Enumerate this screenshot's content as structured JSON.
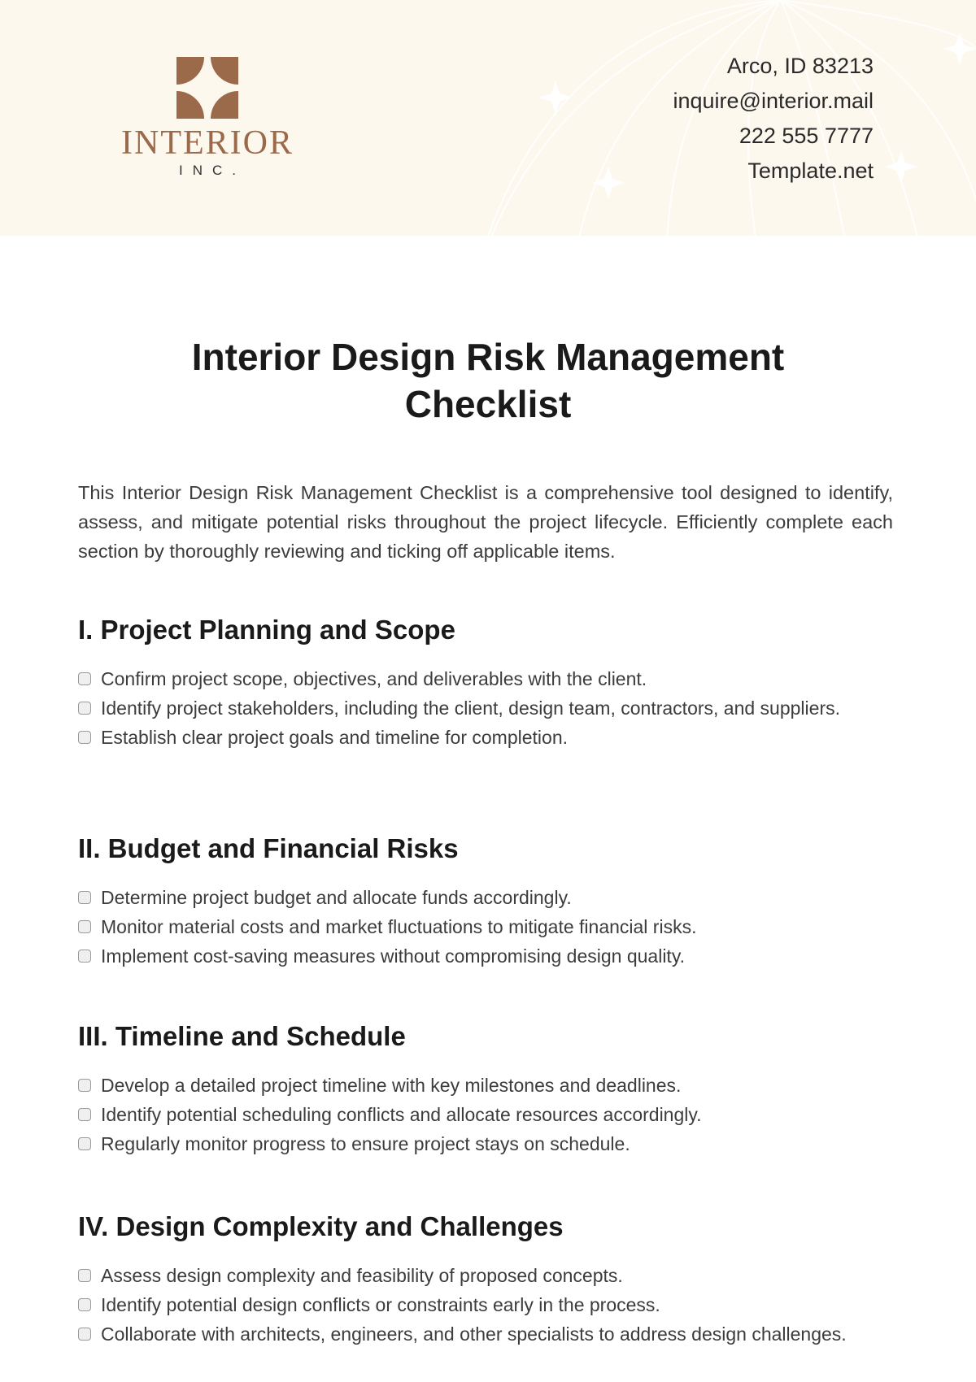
{
  "header": {
    "logo": {
      "name": "INTERIOR",
      "sub": "INC.",
      "brand_color": "#9a6a4b"
    },
    "contact": [
      "Arco, ID 83213",
      "inquire@interior.mail",
      "222 555 7777",
      "Template.net"
    ],
    "background": "#fdf8ee"
  },
  "document": {
    "title_line1": "Interior Design Risk Management",
    "title_line2": "Checklist",
    "intro": "This Interior Design Risk Management Checklist is a comprehensive tool designed to identify, assess, and mitigate potential risks throughout the project lifecycle. Efficiently complete each section by thoroughly reviewing and ticking off applicable items.",
    "sections": [
      {
        "heading": "I. Project Planning and Scope",
        "items": [
          {
            "text": "Confirm project scope, objectives, and deliverables with the client.",
            "checked": false
          },
          {
            "text": "Identify project stakeholders, including the client, design team, contractors, and suppliers.",
            "checked": false
          },
          {
            "text": "Establish clear project goals and timeline for completion.",
            "checked": false
          }
        ]
      },
      {
        "heading": "II. Budget and Financial Risks",
        "items": [
          {
            "text": "Determine project budget and allocate funds accordingly.",
            "checked": false
          },
          {
            "text": "Monitor material costs and market fluctuations to mitigate financial risks.",
            "checked": false
          },
          {
            "text": "Implement cost-saving measures without compromising design quality.",
            "checked": false
          }
        ]
      },
      {
        "heading": "III. Timeline and Schedule",
        "items": [
          {
            "text": "Develop a detailed project timeline with key milestones and deadlines.",
            "checked": false
          },
          {
            "text": "Identify potential scheduling conflicts and allocate resources accordingly.",
            "checked": false
          },
          {
            "text": "Regularly monitor progress to ensure project stays on schedule.",
            "checked": false
          }
        ]
      },
      {
        "heading": "IV. Design Complexity and Challenges",
        "items": [
          {
            "text": "Assess design complexity and feasibility of proposed concepts.",
            "checked": false
          },
          {
            "text": "Identify potential design conflicts or constraints early in the process.",
            "checked": false
          },
          {
            "text": "Collaborate with architects, engineers, and other specialists to address design challenges.",
            "checked": false
          }
        ]
      }
    ]
  }
}
